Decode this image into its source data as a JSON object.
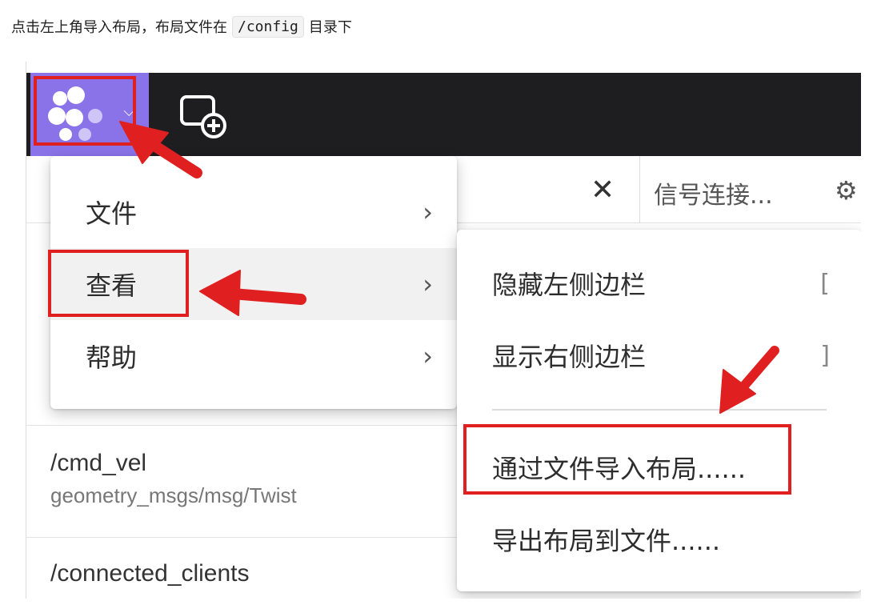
{
  "caption": {
    "before": "点击左上角导入布局，布局文件在",
    "code": "/config",
    "after": "目录下"
  },
  "appbar": {
    "logo_chevron": "⌵",
    "logo_icon": "app-logo-icon",
    "add_panel_icon": "add-panel-icon"
  },
  "toolbar": {
    "close": "✕",
    "signal": "信号连接...",
    "gear": "⚙"
  },
  "menu_main": {
    "items": [
      {
        "label": "文件",
        "arrow": "›"
      },
      {
        "label": "查看",
        "arrow": "›"
      },
      {
        "label": "帮助",
        "arrow": "›"
      }
    ]
  },
  "menu_view": {
    "items": [
      {
        "label": "隐藏左侧边栏",
        "shortcut": "["
      },
      {
        "label": "显示右侧边栏",
        "shortcut": "]"
      },
      {
        "label": "通过文件导入布局......"
      },
      {
        "label": "导出布局到文件......"
      }
    ]
  },
  "topics": [
    {
      "name": "/cmd_vel",
      "type": "geometry_msgs/msg/Twist"
    },
    {
      "name": "/connected_clients",
      "type": ""
    }
  ],
  "colors": {
    "accent": "#8a73e8",
    "appbar": "#1e1e21",
    "annotation_red": "#e02020"
  }
}
